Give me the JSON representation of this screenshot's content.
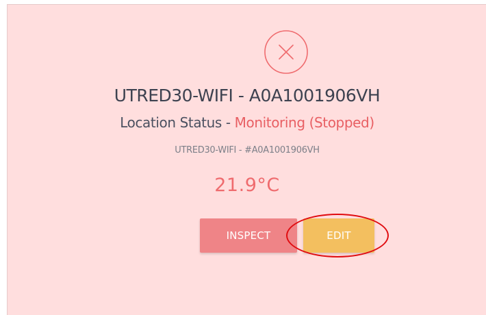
{
  "device": {
    "title": "UTRED30-WIFI - A0A1001906VH",
    "status_label": "Location Status - ",
    "status_value": "Monitoring (Stopped)",
    "subtitle": "UTRED30-WIFI - #A0A1001906VH",
    "temperature": "21.9°C",
    "status_icon": "circle-x-icon"
  },
  "actions": {
    "inspect_label": "INSPECT",
    "edit_label": "EDIT"
  },
  "colors": {
    "card_background": "#ffdede",
    "alert": "#e85f63",
    "inspect_button": "#ef8487",
    "edit_button": "#f3bf5f",
    "highlight_ring": "#e00c10"
  }
}
